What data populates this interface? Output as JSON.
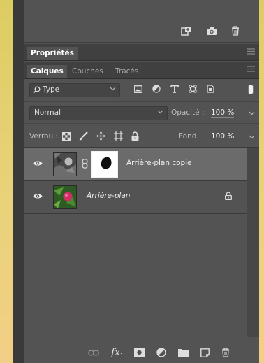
{
  "panel": {
    "properties_tab": "Propriétés",
    "layer_tabs": [
      {
        "label": "Calques",
        "active": true
      },
      {
        "label": "Couches",
        "active": false
      },
      {
        "label": "Tracés",
        "active": false
      }
    ],
    "filter": {
      "label": "Type"
    },
    "blend": {
      "mode": "Normal",
      "opacity_label": "Opacité :",
      "opacity_value": "100 %"
    },
    "lock": {
      "label": "Verrou :",
      "fill_label": "Fond :",
      "fill_value": "100 %"
    },
    "layers": [
      {
        "name": "Arrière-plan copie",
        "selected": true,
        "has_mask": true
      },
      {
        "name": "Arrière-plan",
        "selected": false,
        "locked": true
      }
    ],
    "bottom_icons": [
      "link-icon",
      "fx-icon",
      "add-mask-icon",
      "adjustment-icon",
      "group-folder-icon",
      "new-layer-icon",
      "trash-icon"
    ],
    "colors": {
      "panel_bg": "#535353",
      "tab_bar": "#404040",
      "selected_row": "#6b6b6b"
    }
  }
}
